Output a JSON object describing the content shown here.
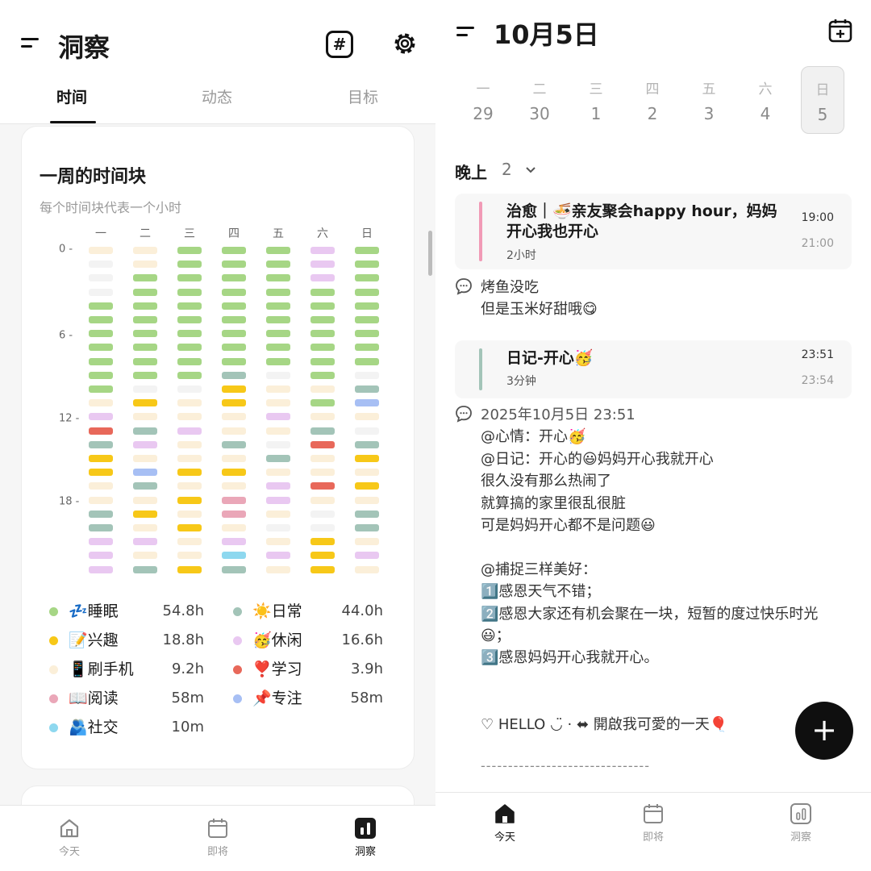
{
  "left": {
    "header": {
      "title": "洞察"
    },
    "tabs": [
      "时间",
      "动态",
      "目标"
    ],
    "card": {
      "title": "一周的时间块",
      "subtitle": "每个时间块代表一个小时",
      "days": [
        "一",
        "二",
        "三",
        "四",
        "五",
        "六",
        "日"
      ],
      "y_labels": [
        "0 -",
        "6 -",
        "12 -",
        "18 -"
      ]
    },
    "legend": [
      {
        "name": "💤睡眠",
        "value": "54.8h",
        "color": "#a6d685"
      },
      {
        "name": "☀️日常",
        "value": "44.0h",
        "color": "#a3c4b8"
      },
      {
        "name": "📝兴趣",
        "value": "18.8h",
        "color": "#f7c818"
      },
      {
        "name": "🥳休闲",
        "value": "16.6h",
        "color": "#e9c8f1"
      },
      {
        "name": "📱刷手机",
        "value": "9.2h",
        "color": "#fbefd9"
      },
      {
        "name": "❣️学习",
        "value": "3.9h",
        "color": "#e8685a"
      },
      {
        "name": "📖阅读",
        "value": "58m",
        "color": "#eaa7b8"
      },
      {
        "name": "📌专注",
        "value": "58m",
        "color": "#a7bff4"
      },
      {
        "name": "🫂社交",
        "value": "10m",
        "color": "#8ed8ef"
      }
    ],
    "nav": [
      "今天",
      "即将",
      "洞察"
    ]
  },
  "chart_data": {
    "type": "heatmap",
    "title": "一周的时间块",
    "subtitle": "每个时间块代表一个小时",
    "x": [
      "一",
      "二",
      "三",
      "四",
      "五",
      "六",
      "日"
    ],
    "y_ticks": [
      0,
      6,
      12,
      18
    ],
    "code_legend": {
      "S": "💤睡眠",
      "D": "☀️日常",
      "I": "📝兴趣",
      "L": "🥳休闲",
      "P": "📱刷手机",
      "X": "❣️学习",
      "R": "📖阅读",
      "F": "📌专注",
      "C": "🫂社交",
      "E": "empty"
    },
    "series": [
      {
        "name": "一",
        "hours": "PEEESSSSSSSPLXDIIPPDDLLL"
      },
      {
        "name": "二",
        "hours": "PPSSSSSSSSEIPDLPFDPIPLPD"
      },
      {
        "name": "三",
        "hours": "SSSSSSSSSSEPPLPPIPIPIPPI"
      },
      {
        "name": "四",
        "hours": "SSSSSSSSSDIIPPDPIPRRPLCD"
      },
      {
        "name": "五",
        "hours": "SSSSSSSSSEPPLPEDPLLPEPLP"
      },
      {
        "name": "六",
        "hours": "LLLSSSSSSSPSPDXPPXPEEIII"
      },
      {
        "name": "日",
        "hours": "SSSSSSSSSEDFPEDIPIPDDPLP"
      }
    ]
  },
  "right": {
    "title": "10月5日",
    "week": [
      {
        "dow": "一",
        "date": "29"
      },
      {
        "dow": "二",
        "date": "30"
      },
      {
        "dow": "三",
        "date": "1"
      },
      {
        "dow": "四",
        "date": "2"
      },
      {
        "dow": "五",
        "date": "3"
      },
      {
        "dow": "六",
        "date": "4"
      },
      {
        "dow": "日",
        "date": "5"
      }
    ],
    "section": {
      "label": "晚上",
      "count": "2"
    },
    "event1": {
      "title1": "治愈｜🍜亲友聚会happy hour，妈妈",
      "title2": "开心我也开心",
      "duration": "2小时",
      "start": "19:00",
      "end": "21:00",
      "color": "#f19ab6"
    },
    "note1": [
      "烤鱼没吃",
      "但是玉米好甜哦😋"
    ],
    "event2": {
      "title": "日记-开心🥳",
      "duration": "3分钟",
      "start": "23:51",
      "end": "23:54",
      "color": "#a3c4b8"
    },
    "note2": [
      "2025年10月5日 23:51",
      "@心情：开心🥳",
      "@日记：开心的😃妈妈开心我就开心",
      "很久没有那么热闹了",
      "就算搞的家里很乱很脏",
      "可是妈妈开心都不是问题😃",
      "",
      "@捕捉三样美好：",
      "1️⃣感恩天气不错；",
      "2️⃣感恩大家还有机会聚在一块，短暂的度过快乐时光",
      "😃；",
      "3️⃣感恩妈妈开心我就开心。"
    ],
    "footer_line": "♡ HELLO ◡̈ · ⬌ 開啟我可愛的一天🎈",
    "separator": "-------------------------------",
    "fab": "+",
    "nav": [
      "今天",
      "即将",
      "洞察"
    ]
  }
}
